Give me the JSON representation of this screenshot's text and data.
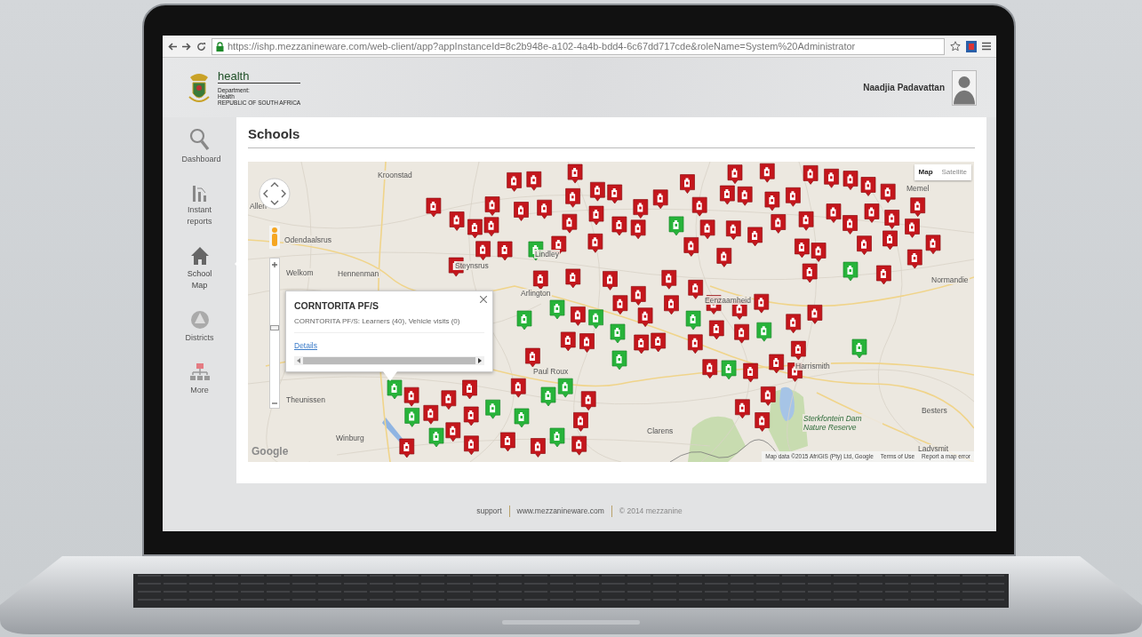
{
  "browser": {
    "url": "https://ishp.mezzanineware.com/web-client/app?appInstanceId=8c2b948e-a102-4a4b-bdd4-6c67dd717cde&roleName=System%20Administrator"
  },
  "header": {
    "logo": {
      "title": "health",
      "lines": [
        "Department:",
        "Health",
        "REPUBLIC OF SOUTH AFRICA"
      ]
    },
    "user_name": "Naadjia Padavattan"
  },
  "sidebar": {
    "items": [
      {
        "label": "Dashboard",
        "selected": false
      },
      {
        "label": "Instant reports",
        "selected": false
      },
      {
        "label": "School Map",
        "selected": true
      },
      {
        "label": "Districts",
        "selected": false
      },
      {
        "label": "More",
        "selected": false
      }
    ]
  },
  "page": {
    "title": "Schools"
  },
  "map": {
    "type_buttons": [
      {
        "label": "Map",
        "selected": true
      },
      {
        "label": "Satellite",
        "selected": false
      }
    ],
    "places": [
      {
        "name": "Kroonstad",
        "kind": "town"
      },
      {
        "name": "Allen",
        "kind": "town"
      },
      {
        "name": "Odendaalsrus",
        "kind": "town"
      },
      {
        "name": "Welkom",
        "kind": "town"
      },
      {
        "name": "Hennenman",
        "kind": "town"
      },
      {
        "name": "Steynsrus",
        "kind": "town"
      },
      {
        "name": "Lindley",
        "kind": "town"
      },
      {
        "name": "Arlington",
        "kind": "town"
      },
      {
        "name": "Eenzaamheid",
        "kind": "town"
      },
      {
        "name": "Memel",
        "kind": "town"
      },
      {
        "name": "Normandie",
        "kind": "town"
      },
      {
        "name": "Harrismith",
        "kind": "town"
      },
      {
        "name": "Paul Roux",
        "kind": "town"
      },
      {
        "name": "Theunissen",
        "kind": "town"
      },
      {
        "name": "Winburg",
        "kind": "town"
      },
      {
        "name": "Besters",
        "kind": "town"
      },
      {
        "name": "Ladysmit",
        "kind": "town"
      },
      {
        "name": "Clarens",
        "kind": "town"
      },
      {
        "name": "Sterkfontein Dam Nature Reserve",
        "kind": "park"
      }
    ],
    "info_window": {
      "title": "CORNTORITA PF/S",
      "text": "CORNTORITA PF/S: Learners (40), Vehicle visits (0)",
      "link": "Details"
    },
    "zoom": {
      "level": 0.55
    },
    "google_logo": "Google",
    "attribution": "Map data ©2015 AfriGIS (Pty) Ltd, Google",
    "links": [
      "Terms of Use",
      "Report a map error"
    ]
  },
  "footer": {
    "items": [
      "support",
      "www.mezzanineware.com",
      "© 2014 mezzanine"
    ]
  }
}
